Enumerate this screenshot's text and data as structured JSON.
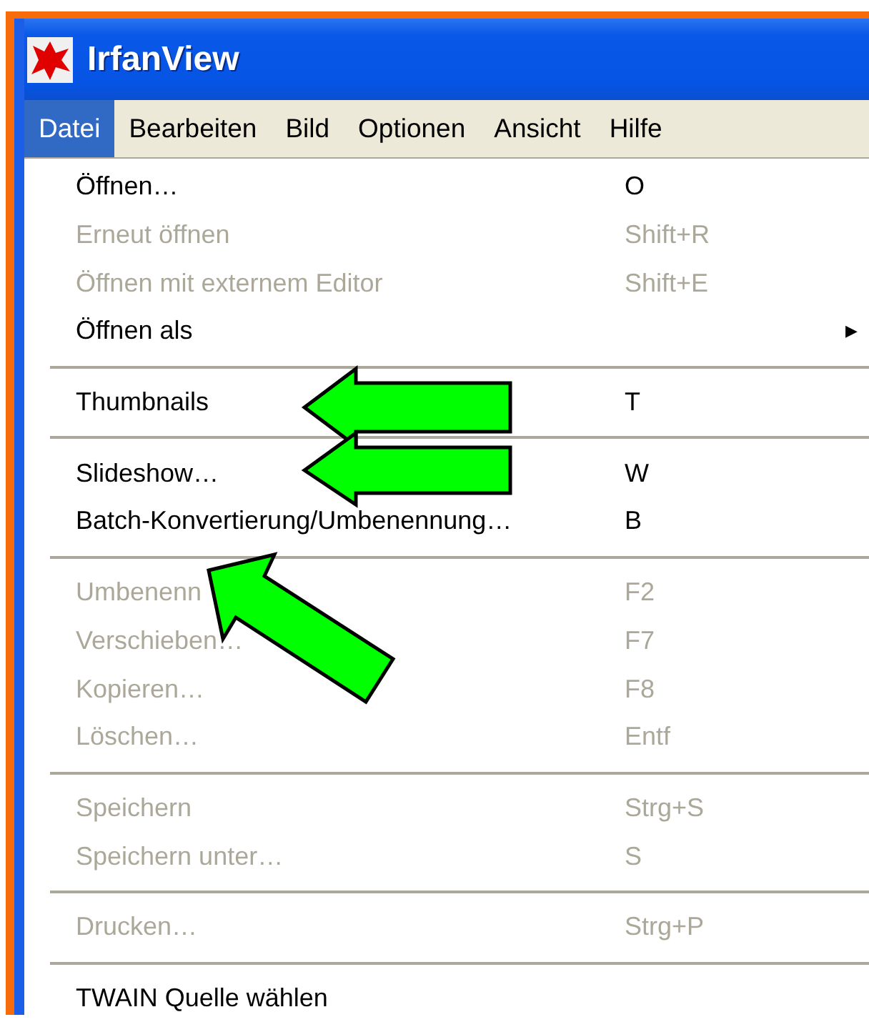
{
  "window": {
    "title": "IrfanView"
  },
  "menu_bar": [
    {
      "label": "Datei",
      "selected": true
    },
    {
      "label": "Bearbeiten",
      "selected": false
    },
    {
      "label": "Bild",
      "selected": false
    },
    {
      "label": "Optionen",
      "selected": false
    },
    {
      "label": "Ansicht",
      "selected": false
    },
    {
      "label": "Hilfe",
      "selected": false
    }
  ],
  "menu": [
    {
      "kind": "item",
      "label": "Öffnen…",
      "shortcut": "O",
      "disabled": false
    },
    {
      "kind": "item",
      "label": "Erneut öffnen",
      "shortcut": "Shift+R",
      "disabled": true
    },
    {
      "kind": "item",
      "label": "Öffnen mit externem Editor",
      "shortcut": "Shift+E",
      "disabled": true
    },
    {
      "kind": "submenu",
      "label": "Öffnen als",
      "arrow": "▶",
      "disabled": false
    },
    {
      "kind": "separator"
    },
    {
      "kind": "item",
      "label": "Thumbnails",
      "shortcut": "T",
      "disabled": false
    },
    {
      "kind": "separator"
    },
    {
      "kind": "item",
      "label": "Slideshow…",
      "shortcut": "W",
      "disabled": false
    },
    {
      "kind": "item",
      "label": "Batch-Konvertierung/Umbenennung…",
      "shortcut": "B",
      "disabled": false
    },
    {
      "kind": "separator"
    },
    {
      "kind": "item",
      "label": "Umbenenn",
      "shortcut": "F2",
      "disabled": true
    },
    {
      "kind": "item",
      "label": "Verschieben…",
      "shortcut": "F7",
      "disabled": true
    },
    {
      "kind": "item",
      "label": "Kopieren…",
      "shortcut": "F8",
      "disabled": true
    },
    {
      "kind": "item",
      "label": "Löschen…",
      "shortcut": "Entf",
      "disabled": true
    },
    {
      "kind": "separator"
    },
    {
      "kind": "item",
      "label": "Speichern",
      "shortcut": "Strg+S",
      "disabled": true
    },
    {
      "kind": "item",
      "label": "Speichern unter…",
      "shortcut": "S",
      "disabled": true
    },
    {
      "kind": "separator"
    },
    {
      "kind": "item",
      "label": "Drucken…",
      "shortcut": "Strg+P",
      "disabled": true
    },
    {
      "kind": "separator"
    },
    {
      "kind": "item",
      "label": "TWAIN Quelle wählen",
      "disabled": false
    }
  ]
}
